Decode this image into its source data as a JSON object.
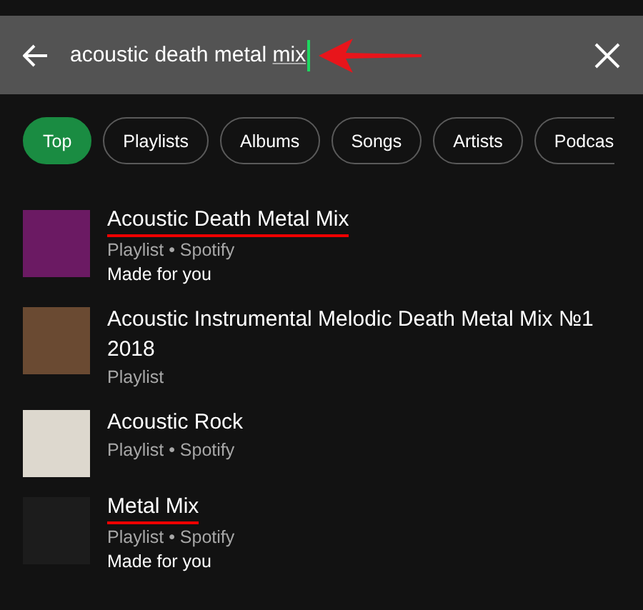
{
  "search": {
    "query": "acoustic death metal ",
    "composing": "mix",
    "arrow_marked": true
  },
  "filters": [
    {
      "label": "Top",
      "selected": true
    },
    {
      "label": "Playlists",
      "selected": false
    },
    {
      "label": "Albums",
      "selected": false
    },
    {
      "label": "Songs",
      "selected": false
    },
    {
      "label": "Artists",
      "selected": false
    },
    {
      "label": "Podcas",
      "selected": false
    }
  ],
  "results": [
    {
      "title": "Acoustic Death Metal Mix",
      "subtitle": "Playlist • Spotify",
      "note": "Made for you",
      "underlined": true,
      "color": "#6b1a63"
    },
    {
      "title": "Acoustic Instrumental Melodic Death Metal Mix №1 2018",
      "subtitle": "Playlist",
      "underlined": false,
      "color": "#6a4a32"
    },
    {
      "title": "Acoustic Rock",
      "subtitle": "Playlist • Spotify",
      "underlined": false,
      "color": "#ddd8ce"
    },
    {
      "title": "Metal Mix",
      "subtitle": "Playlist • Spotify",
      "note": "Made for you",
      "underlined": true,
      "color": "#1c1c1c"
    }
  ]
}
